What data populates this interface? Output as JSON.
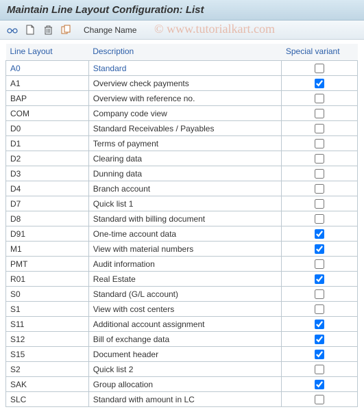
{
  "title": "Maintain Line Layout Configuration: List",
  "toolbar": {
    "change_name": "Change Name"
  },
  "watermark": "© www.tutorialkart.com",
  "columns": {
    "code": "Line Layout",
    "desc": "Description",
    "variant": "Special variant"
  },
  "rows": [
    {
      "code": "A0",
      "desc": "Standard",
      "variant": false
    },
    {
      "code": "A1",
      "desc": "Overview check payments",
      "variant": true
    },
    {
      "code": "BAP",
      "desc": "Overview with reference no.",
      "variant": false
    },
    {
      "code": "COM",
      "desc": "Company code view",
      "variant": false
    },
    {
      "code": "D0",
      "desc": "Standard Receivables / Payables",
      "variant": false
    },
    {
      "code": "D1",
      "desc": "Terms of payment",
      "variant": false
    },
    {
      "code": "D2",
      "desc": "Clearing data",
      "variant": false
    },
    {
      "code": "D3",
      "desc": "Dunning data",
      "variant": false
    },
    {
      "code": "D4",
      "desc": "Branch account",
      "variant": false
    },
    {
      "code": "D7",
      "desc": "Quick list 1",
      "variant": false
    },
    {
      "code": "D8",
      "desc": "Standard with billing document",
      "variant": false
    },
    {
      "code": "D91",
      "desc": "One-time account data",
      "variant": true
    },
    {
      "code": "M1",
      "desc": "View with material numbers",
      "variant": true
    },
    {
      "code": "PMT",
      "desc": "Audit information",
      "variant": false
    },
    {
      "code": "R01",
      "desc": "Real Estate",
      "variant": true
    },
    {
      "code": "S0",
      "desc": "Standard (G/L account)",
      "variant": false
    },
    {
      "code": "S1",
      "desc": "View with cost centers",
      "variant": false
    },
    {
      "code": "S11",
      "desc": "Additional account assignment",
      "variant": true
    },
    {
      "code": "S12",
      "desc": "Bill of exchange data",
      "variant": true
    },
    {
      "code": "S15",
      "desc": "Document header",
      "variant": true
    },
    {
      "code": "S2",
      "desc": "Quick list 2",
      "variant": false
    },
    {
      "code": "SAK",
      "desc": "Group allocation",
      "variant": true
    },
    {
      "code": "SLC",
      "desc": "Standard with amount in LC",
      "variant": false
    }
  ]
}
